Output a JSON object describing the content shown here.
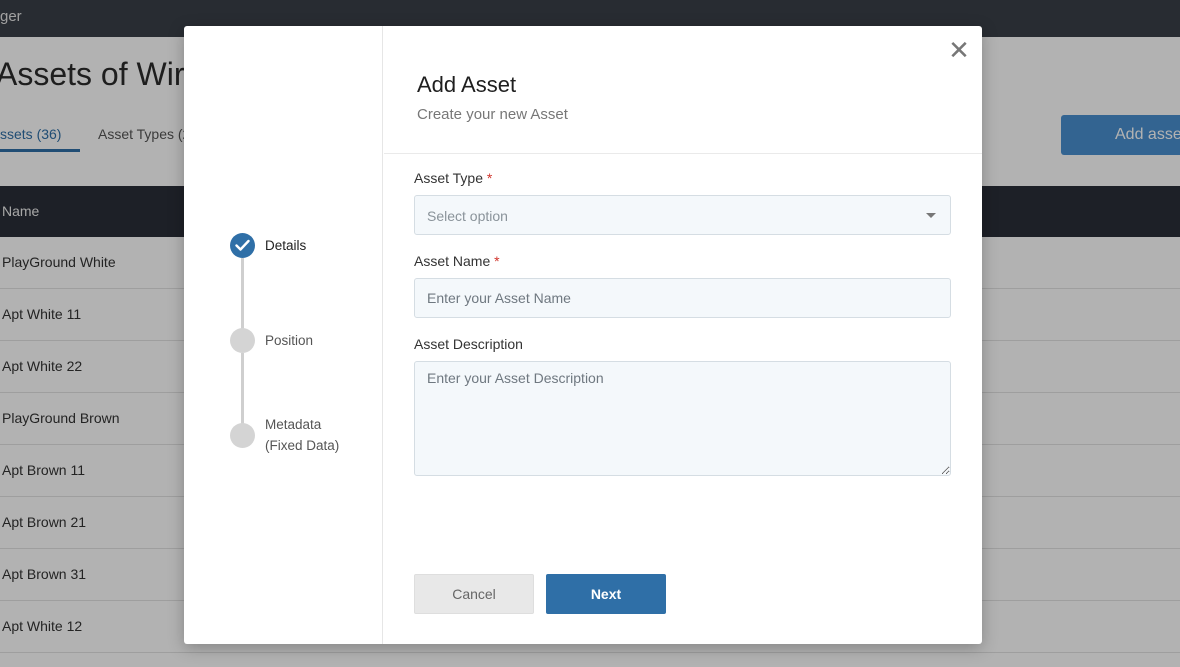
{
  "app": {
    "title": "ger"
  },
  "page": {
    "title": "Assets of Wir",
    "tabs": [
      {
        "label": "ssets (36)",
        "active": true
      },
      {
        "label": "Asset Types (2",
        "active": false
      }
    ],
    "add_button_label": "Add asse"
  },
  "table": {
    "column_name": "Name",
    "rows": [
      "PlayGround White",
      "Apt White 11",
      "Apt White 22",
      "PlayGround Brown",
      "Apt Brown 11",
      "Apt Brown 21",
      "Apt Brown 31",
      "Apt White 12"
    ]
  },
  "modal": {
    "title": "Add Asset",
    "subtitle": "Create your new Asset",
    "close_icon": "close-icon",
    "steps": [
      {
        "label": "Details",
        "status": "done"
      },
      {
        "label": "Position",
        "status": "pending"
      },
      {
        "label_line1": "Metadata",
        "label_line2": "(Fixed Data)",
        "status": "pending"
      }
    ],
    "fields": {
      "asset_type": {
        "label": "Asset Type",
        "required_mark": "*",
        "placeholder": "Select option"
      },
      "asset_name": {
        "label": "Asset Name",
        "required_mark": "*",
        "placeholder": "Enter your Asset Name",
        "value": ""
      },
      "asset_description": {
        "label": "Asset Description",
        "placeholder": "Enter your Asset Description",
        "value": ""
      }
    },
    "buttons": {
      "cancel": "Cancel",
      "next": "Next"
    }
  },
  "colors": {
    "primary": "#2f6fa7",
    "header_bg": "#3a3f48",
    "table_head_bg": "#2a2f38",
    "required": "#d0342c"
  }
}
